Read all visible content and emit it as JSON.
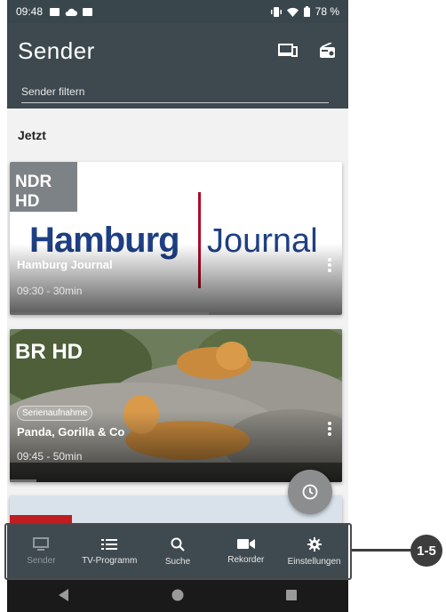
{
  "status_bar": {
    "time": "09:48",
    "battery": "78 %"
  },
  "app_bar": {
    "title": "Sender",
    "filter_placeholder": "Sender filtern"
  },
  "section": {
    "label": "Jetzt"
  },
  "cards": [
    {
      "channel_logo": "NDR HD",
      "image_title": "Hamburg",
      "image_subtitle": "Journal",
      "title": "Hamburg Journal",
      "time": "09:30 - 30min",
      "progress": 0.6
    },
    {
      "channel_logo": "BR HD",
      "badge": "Serienaufnahme",
      "title": "Panda, Gorilla & Co",
      "time": "09:45 - 50min",
      "progress": 0.08
    }
  ],
  "bottom_nav": [
    {
      "label": "Sender",
      "icon": "tv-icon",
      "disabled": true
    },
    {
      "label": "TV-Programm",
      "icon": "list-icon"
    },
    {
      "label": "Suche",
      "icon": "search-icon"
    },
    {
      "label": "Rekorder",
      "icon": "video-camera-icon"
    },
    {
      "label": "Einstellungen",
      "icon": "gear-icon"
    }
  ],
  "callout": {
    "label": "1-5"
  },
  "colors": {
    "app_bar": "#3d494f",
    "bottom_nav": "#3f4a50",
    "ndr_blue": "#1e3f83",
    "ndr_red": "#b10a2a"
  }
}
